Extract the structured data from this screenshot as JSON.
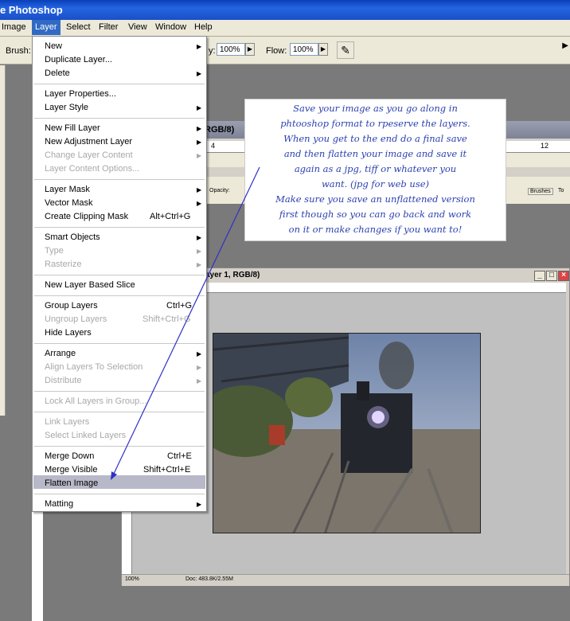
{
  "app": {
    "title": "e Photoshop"
  },
  "menubar": [
    "Image",
    "Layer",
    "Select",
    "Filter",
    "View",
    "Window",
    "Help"
  ],
  "options": {
    "brush_label": "Brush:",
    "opacity_label": "y:",
    "opacity_value": "100%",
    "flow_label": "Flow:",
    "flow_value": "100%",
    "airbrush_icon": "airbrush-icon"
  },
  "back_window": {
    "title": "RGB/8)",
    "ruler_marks": [
      "4",
      "12"
    ],
    "tab_labels": [
      "Brushes",
      "To"
    ],
    "opacity_text": "Opacity:"
  },
  "main_window": {
    "title": "ayer 1, RGB/8)",
    "zoom": "100%",
    "doc": "Doc: 483.8K/2.55M"
  },
  "layer_menu": {
    "items": [
      {
        "label": "New",
        "submenu": true
      },
      {
        "label": "Duplicate Layer..."
      },
      {
        "label": "Delete",
        "submenu": true
      },
      {
        "label": "Layer Properties..."
      },
      {
        "label": "Layer Style",
        "submenu": true
      },
      {
        "label": "New Fill Layer",
        "submenu": true
      },
      {
        "label": "New Adjustment Layer",
        "submenu": true
      },
      {
        "label": "Change Layer Content",
        "disabled": true,
        "submenu": true
      },
      {
        "label": "Layer Content Options...",
        "disabled": true
      },
      {
        "label": "Layer Mask",
        "submenu": true
      },
      {
        "label": "Vector Mask",
        "submenu": true
      },
      {
        "label": "Create Clipping Mask",
        "shortcut": "Alt+Ctrl+G"
      },
      {
        "label": "Smart Objects",
        "submenu": true
      },
      {
        "label": "Type",
        "disabled": true,
        "submenu": true
      },
      {
        "label": "Rasterize",
        "disabled": true,
        "submenu": true
      },
      {
        "label": "New Layer Based Slice"
      },
      {
        "label": "Group Layers",
        "shortcut": "Ctrl+G"
      },
      {
        "label": "Ungroup Layers",
        "shortcut": "Shift+Ctrl+G",
        "disabled": true
      },
      {
        "label": "Hide Layers"
      },
      {
        "label": "Arrange",
        "submenu": true
      },
      {
        "label": "Align Layers To Selection",
        "disabled": true,
        "submenu": true
      },
      {
        "label": "Distribute",
        "disabled": true,
        "submenu": true
      },
      {
        "label": "Lock All Layers in Group...",
        "disabled": true
      },
      {
        "label": "Link Layers",
        "disabled": true
      },
      {
        "label": "Select Linked Layers",
        "disabled": true
      },
      {
        "label": "Merge Down",
        "shortcut": "Ctrl+E"
      },
      {
        "label": "Merge Visible",
        "shortcut": "Shift+Ctrl+E"
      },
      {
        "label": "Flatten Image",
        "highlighted": true
      },
      {
        "label": "Matting",
        "submenu": true
      }
    ]
  },
  "annotation": {
    "lines": [
      "Save your image as you go along in",
      "phtooshop format to rpeserve the layers.",
      "When you get to the end do a final save",
      "and then flatten your image and save it",
      "again as a jpg, tiff or whatever you",
      "want. (jpg for web use)",
      "Make sure you save an unflattened version",
      "first though so you can go back and work",
      "on it or make changes if you want to!"
    ]
  },
  "colors": {
    "title_bar": "#1a50c8",
    "menu_highlight": "#b7b8c8",
    "annotation_text": "#2a3fb0",
    "arrow": "#3030c8"
  }
}
